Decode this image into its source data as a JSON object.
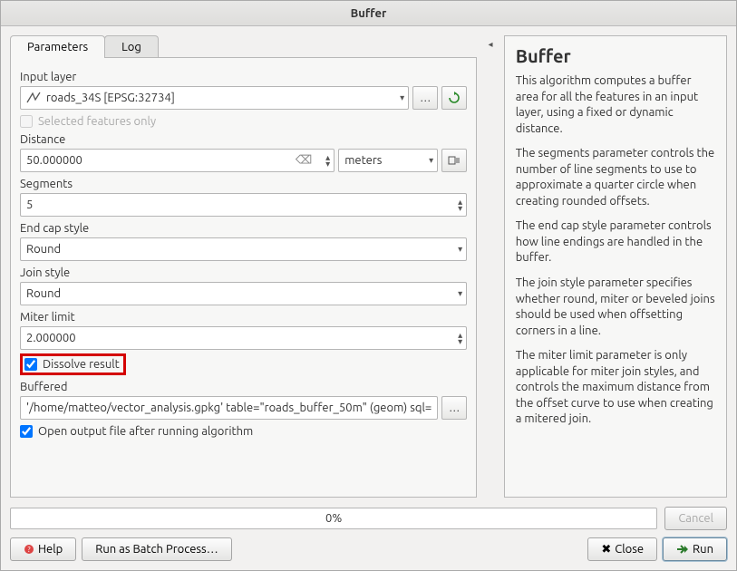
{
  "window": {
    "title": "Buffer"
  },
  "tabs": {
    "parameters": "Parameters",
    "log": "Log",
    "active": "parameters"
  },
  "fields": {
    "input_layer_label": "Input layer",
    "input_layer_value": "roads_34S [EPSG:32734]",
    "selected_only_label": "Selected features only",
    "distance_label": "Distance",
    "distance_value": "50.000000",
    "distance_units": "meters",
    "segments_label": "Segments",
    "segments_value": "5",
    "endcap_label": "End cap style",
    "endcap_value": "Round",
    "joinstyle_label": "Join style",
    "joinstyle_value": "Round",
    "miter_label": "Miter limit",
    "miter_value": "2.000000",
    "dissolve_label": "Dissolve result",
    "buffered_label": "Buffered",
    "buffered_value": "'/home/matteo/vector_analysis.gpkg' table=\"roads_buffer_50m\" (geom) sql=",
    "open_after_label": "Open output file after running algorithm"
  },
  "help": {
    "title": "Buffer",
    "p1": "This algorithm computes a buffer area for all the features in an input layer, using a fixed or dynamic distance.",
    "p2": "The segments parameter controls the number of line segments to use to approximate a quarter circle when creating rounded offsets.",
    "p3": "The end cap style parameter controls how line endings are handled in the buffer.",
    "p4": "The join style parameter specifies whether round, miter or beveled joins should be used when offsetting corners in a line.",
    "p5": "The miter limit parameter is only applicable for miter join styles, and controls the maximum distance from the offset curve to use when creating a mitered join."
  },
  "footer": {
    "progress": "0%",
    "cancel": "Cancel",
    "help": "Help",
    "batch": "Run as Batch Process…",
    "close": "Close",
    "run": "Run"
  }
}
